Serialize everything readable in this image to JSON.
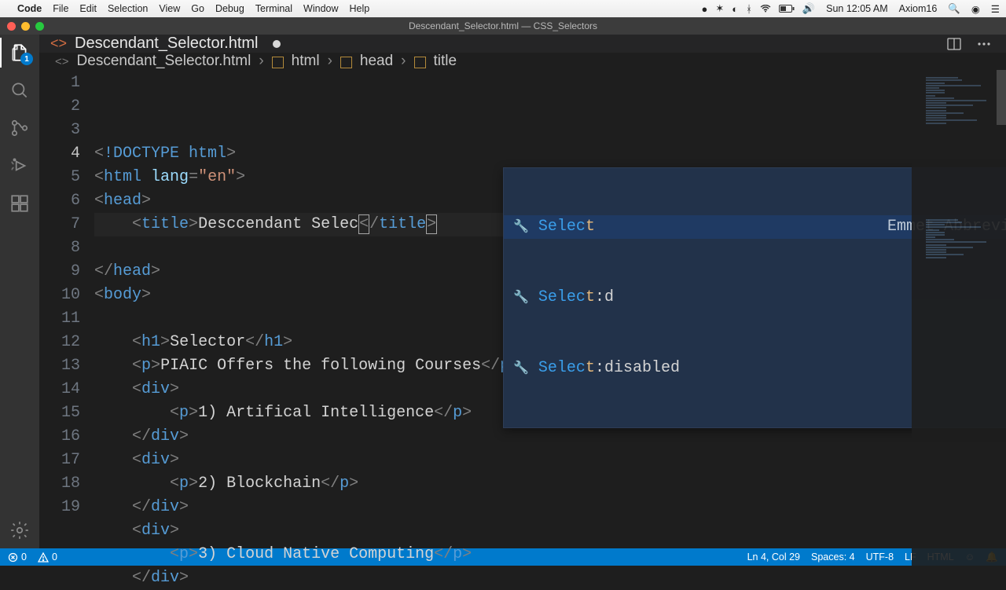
{
  "menubar": {
    "apple": "",
    "app": "Code",
    "items": [
      "File",
      "Edit",
      "Selection",
      "View",
      "Go",
      "Debug",
      "Terminal",
      "Window",
      "Help"
    ],
    "clock": "Sun 12:05 AM",
    "user": "Axiom16"
  },
  "window": {
    "title": "Descendant_Selector.html — CSS_Selectors"
  },
  "activity": {
    "explorer_badge": "1"
  },
  "tab": {
    "filename": "Descendant_Selector.html"
  },
  "breadcrumbs": {
    "file": "Descendant_Selector.html",
    "parts": [
      "html",
      "head",
      "title"
    ]
  },
  "code": {
    "lines": [
      {
        "n": "1",
        "tokens": [
          [
            "<",
            "punc"
          ],
          [
            "!",
            "doctype"
          ],
          [
            "DOCTYPE html",
            "doctype"
          ],
          [
            ">",
            "punc"
          ]
        ]
      },
      {
        "n": "2",
        "tokens": [
          [
            "<",
            "punc"
          ],
          [
            "html",
            "tag"
          ],
          [
            " ",
            "text"
          ],
          [
            "lang",
            "attr"
          ],
          [
            "=",
            "punc"
          ],
          [
            "\"en\"",
            "str"
          ],
          [
            ">",
            "punc"
          ]
        ]
      },
      {
        "n": "3",
        "tokens": [
          [
            "<",
            "punc"
          ],
          [
            "head",
            "tag"
          ],
          [
            ">",
            "punc"
          ]
        ]
      },
      {
        "n": "4",
        "indent": "    ",
        "tokens": [
          [
            "<",
            "punc"
          ],
          [
            "title",
            "tag"
          ],
          [
            ">",
            "punc"
          ],
          [
            "Desccendant Selec",
            "text"
          ],
          [
            "<",
            "boxpunc"
          ],
          [
            "/",
            "punc"
          ],
          [
            "title",
            "tag"
          ],
          [
            ">",
            "boxpunc"
          ]
        ]
      },
      {
        "n": "5",
        "tokens": []
      },
      {
        "n": "6",
        "tokens": [
          [
            "</",
            "punc"
          ],
          [
            "head",
            "tag"
          ],
          [
            ">",
            "punc"
          ]
        ]
      },
      {
        "n": "7",
        "tokens": [
          [
            "<",
            "punc"
          ],
          [
            "body",
            "tag"
          ],
          [
            ">",
            "punc"
          ]
        ]
      },
      {
        "n": "8",
        "tokens": []
      },
      {
        "n": "9",
        "indent": "    ",
        "tokens": [
          [
            "<",
            "punc"
          ],
          [
            "h1",
            "tag"
          ],
          [
            ">",
            "punc"
          ],
          [
            "Selector",
            "text"
          ],
          [
            "</",
            "punc"
          ],
          [
            "h1",
            "tag"
          ],
          [
            ">",
            "punc"
          ]
        ]
      },
      {
        "n": "10",
        "indent": "    ",
        "tokens": [
          [
            "<",
            "punc"
          ],
          [
            "p",
            "tag"
          ],
          [
            ">",
            "punc"
          ],
          [
            "PIAIC Offers the following Courses",
            "text"
          ],
          [
            "</",
            "punc"
          ],
          [
            "p",
            "tag"
          ],
          [
            ">",
            "punc"
          ]
        ]
      },
      {
        "n": "11",
        "indent": "    ",
        "tokens": [
          [
            "<",
            "punc"
          ],
          [
            "div",
            "tag"
          ],
          [
            ">",
            "punc"
          ]
        ]
      },
      {
        "n": "12",
        "indent": "        ",
        "tokens": [
          [
            "<",
            "punc"
          ],
          [
            "p",
            "tag"
          ],
          [
            ">",
            "punc"
          ],
          [
            "1) Artifical Intelligence",
            "text"
          ],
          [
            "</",
            "punc"
          ],
          [
            "p",
            "tag"
          ],
          [
            ">",
            "punc"
          ]
        ]
      },
      {
        "n": "13",
        "indent": "    ",
        "tokens": [
          [
            "</",
            "punc"
          ],
          [
            "div",
            "tag"
          ],
          [
            ">",
            "punc"
          ]
        ]
      },
      {
        "n": "14",
        "indent": "    ",
        "tokens": [
          [
            "<",
            "punc"
          ],
          [
            "div",
            "tag"
          ],
          [
            ">",
            "punc"
          ]
        ]
      },
      {
        "n": "15",
        "indent": "        ",
        "tokens": [
          [
            "<",
            "punc"
          ],
          [
            "p",
            "tag"
          ],
          [
            ">",
            "punc"
          ],
          [
            "2) Blockchain",
            "text"
          ],
          [
            "</",
            "punc"
          ],
          [
            "p",
            "tag"
          ],
          [
            ">",
            "punc"
          ]
        ]
      },
      {
        "n": "16",
        "indent": "    ",
        "tokens": [
          [
            "</",
            "punc"
          ],
          [
            "div",
            "tag"
          ],
          [
            ">",
            "punc"
          ]
        ]
      },
      {
        "n": "17",
        "indent": "    ",
        "tokens": [
          [
            "<",
            "punc"
          ],
          [
            "div",
            "tag"
          ],
          [
            ">",
            "punc"
          ]
        ]
      },
      {
        "n": "18",
        "indent": "        ",
        "tokens": [
          [
            "<",
            "punc"
          ],
          [
            "p",
            "tag"
          ],
          [
            ">",
            "punc"
          ],
          [
            "3) Cloud Native Computing",
            "text"
          ],
          [
            "</",
            "punc"
          ],
          [
            "p",
            "tag"
          ],
          [
            ">",
            "punc"
          ]
        ]
      },
      {
        "n": "19",
        "indent": "    ",
        "tokens": [
          [
            "</",
            "punc"
          ],
          [
            "div",
            "tag"
          ],
          [
            ">",
            "punc"
          ]
        ]
      }
    ],
    "current_line_index": 3
  },
  "suggest": {
    "hint": "Emmet Abbreviation",
    "items": [
      {
        "match": "Selec",
        "rest": "t",
        "rest2": ""
      },
      {
        "match": "Selec",
        "rest": "t",
        "rest2": ":d"
      },
      {
        "match": "Selec",
        "rest": "t",
        "rest2": ":disabled"
      }
    ]
  },
  "status": {
    "errors": "0",
    "warnings": "0",
    "cursor": "Ln 4, Col 29",
    "spaces": "Spaces: 4",
    "encoding": "UTF-8",
    "eol": "LF",
    "language": "HTML",
    "smiley": "☺",
    "bell": "🔔"
  }
}
